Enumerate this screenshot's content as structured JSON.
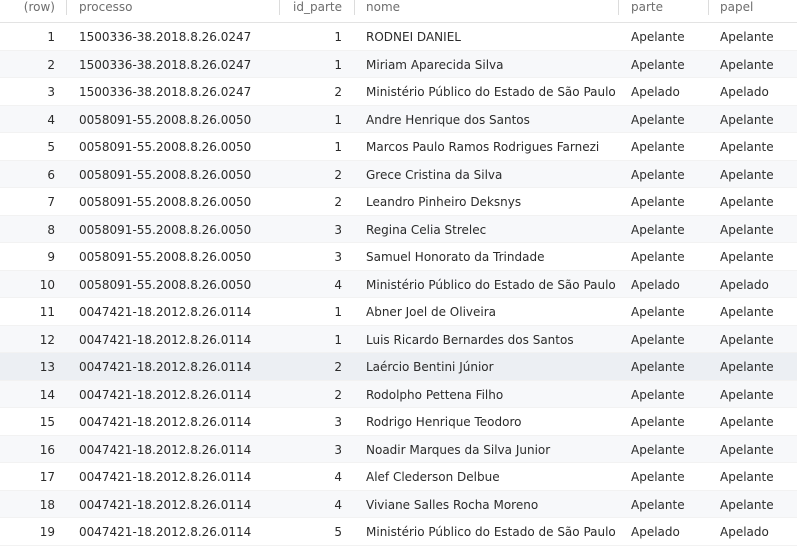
{
  "columns": {
    "row": "(row)",
    "processo": "processo",
    "id_parte": "id_parte",
    "nome": "nome",
    "parte": "parte",
    "papel": "papel"
  },
  "rows": [
    {
      "row": "1",
      "processo": "1500336-38.2018.8.26.0247",
      "id_parte": "1",
      "nome": "RODNEI DANIEL",
      "parte": "Apelante",
      "papel": "Apelante"
    },
    {
      "row": "2",
      "processo": "1500336-38.2018.8.26.0247",
      "id_parte": "1",
      "nome": "Miriam Aparecida Silva",
      "parte": "Apelante",
      "papel": "Apelante"
    },
    {
      "row": "3",
      "processo": "1500336-38.2018.8.26.0247",
      "id_parte": "2",
      "nome": "Ministério Público do Estado de São Paulo",
      "parte": "Apelado",
      "papel": "Apelado"
    },
    {
      "row": "4",
      "processo": "0058091-55.2008.8.26.0050",
      "id_parte": "1",
      "nome": "Andre Henrique dos Santos",
      "parte": "Apelante",
      "papel": "Apelante"
    },
    {
      "row": "5",
      "processo": "0058091-55.2008.8.26.0050",
      "id_parte": "1",
      "nome": "Marcos Paulo Ramos Rodrigues Farnezi",
      "parte": "Apelante",
      "papel": "Apelante"
    },
    {
      "row": "6",
      "processo": "0058091-55.2008.8.26.0050",
      "id_parte": "2",
      "nome": "Grece Cristina da Silva",
      "parte": "Apelante",
      "papel": "Apelante"
    },
    {
      "row": "7",
      "processo": "0058091-55.2008.8.26.0050",
      "id_parte": "2",
      "nome": "Leandro Pinheiro Deksnys",
      "parte": "Apelante",
      "papel": "Apelante"
    },
    {
      "row": "8",
      "processo": "0058091-55.2008.8.26.0050",
      "id_parte": "3",
      "nome": "Regina Celia Strelec",
      "parte": "Apelante",
      "papel": "Apelante"
    },
    {
      "row": "9",
      "processo": "0058091-55.2008.8.26.0050",
      "id_parte": "3",
      "nome": "Samuel Honorato da Trindade",
      "parte": "Apelante",
      "papel": "Apelante"
    },
    {
      "row": "10",
      "processo": "0058091-55.2008.8.26.0050",
      "id_parte": "4",
      "nome": "Ministério Público do Estado de São Paulo",
      "parte": "Apelado",
      "papel": "Apelado"
    },
    {
      "row": "11",
      "processo": "0047421-18.2012.8.26.0114",
      "id_parte": "1",
      "nome": "Abner Joel de Oliveira",
      "parte": "Apelante",
      "papel": "Apelante"
    },
    {
      "row": "12",
      "processo": "0047421-18.2012.8.26.0114",
      "id_parte": "1",
      "nome": "Luis Ricardo Bernardes dos Santos",
      "parte": "Apelante",
      "papel": "Apelante"
    },
    {
      "row": "13",
      "processo": "0047421-18.2012.8.26.0114",
      "id_parte": "2",
      "nome": "Laércio Bentini Júnior",
      "parte": "Apelante",
      "papel": "Apelante"
    },
    {
      "row": "14",
      "processo": "0047421-18.2012.8.26.0114",
      "id_parte": "2",
      "nome": "Rodolpho Pettena Filho",
      "parte": "Apelante",
      "papel": "Apelante"
    },
    {
      "row": "15",
      "processo": "0047421-18.2012.8.26.0114",
      "id_parte": "3",
      "nome": "Rodrigo Henrique Teodoro",
      "parte": "Apelante",
      "papel": "Apelante"
    },
    {
      "row": "16",
      "processo": "0047421-18.2012.8.26.0114",
      "id_parte": "3",
      "nome": "Noadir Marques da Silva Junior",
      "parte": "Apelante",
      "papel": "Apelante"
    },
    {
      "row": "17",
      "processo": "0047421-18.2012.8.26.0114",
      "id_parte": "4",
      "nome": "Alef Clederson Delbue",
      "parte": "Apelante",
      "papel": "Apelante"
    },
    {
      "row": "18",
      "processo": "0047421-18.2012.8.26.0114",
      "id_parte": "4",
      "nome": "Viviane Salles Rocha Moreno",
      "parte": "Apelante",
      "papel": "Apelante"
    },
    {
      "row": "19",
      "processo": "0047421-18.2012.8.26.0114",
      "id_parte": "5",
      "nome": "Ministério Público do Estado de São Paulo",
      "parte": "Apelado",
      "papel": "Apelado"
    }
  ]
}
